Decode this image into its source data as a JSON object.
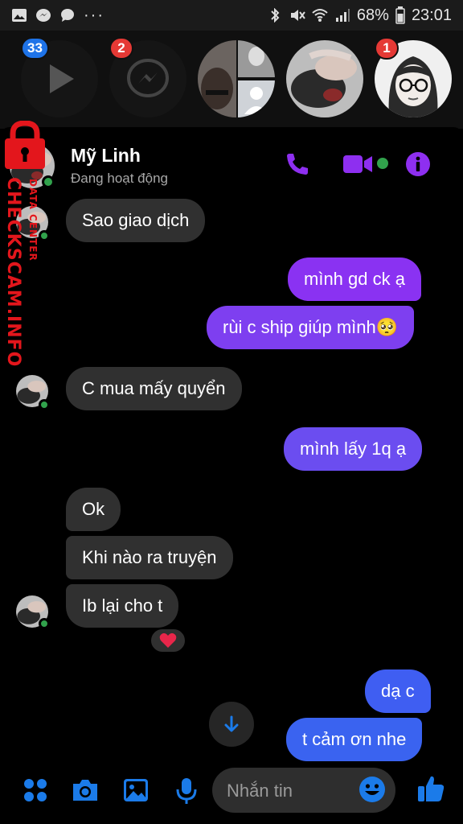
{
  "status_bar": {
    "battery": "68%",
    "time": "23:01",
    "overflow": "···"
  },
  "chat_heads": [
    {
      "name": "video-chat-head",
      "badge": "33",
      "badge_color": "#1e73e8"
    },
    {
      "name": "messenger-chat-head",
      "badge": "2",
      "badge_color": "#e53935"
    },
    {
      "name": "group-chat-head",
      "badge": ""
    },
    {
      "name": "active-chat-head",
      "badge": ""
    },
    {
      "name": "girl-chat-head",
      "badge": "1",
      "badge_color": "#e53935"
    }
  ],
  "header": {
    "name": "Mỹ Linh",
    "status": "Đang hoạt động"
  },
  "messages": [
    {
      "side": "in",
      "text": "Sao giao dịch"
    },
    {
      "side": "out",
      "text": "mình gd ck ạ"
    },
    {
      "side": "out",
      "text": "rùi c ship giúp mình🥺"
    },
    {
      "side": "in",
      "text": "C mua mấy quyển"
    },
    {
      "side": "out",
      "text": "mình lấy 1q ạ"
    },
    {
      "side": "in",
      "text": "Ok"
    },
    {
      "side": "in",
      "text": "Khi nào ra truyện"
    },
    {
      "side": "in",
      "text": "Ib lại cho t"
    },
    {
      "side": "out",
      "text": "dạ c"
    },
    {
      "side": "out",
      "text": "t cảm ơn nhe"
    }
  ],
  "reaction": "❤️",
  "composer": {
    "placeholder": "Nhắn tin"
  },
  "watermark": {
    "main": "CHECKSCAM.INFO",
    "sub": "DATA CENTER"
  },
  "colors": {
    "accent_purple": "#8a2be2",
    "bubble_purple": "#8e2ff0",
    "bubble_blue": "#3d5cf0",
    "icon_blue": "#1b7be9",
    "online_green": "#31a24c",
    "incoming_bubble": "#303030"
  }
}
